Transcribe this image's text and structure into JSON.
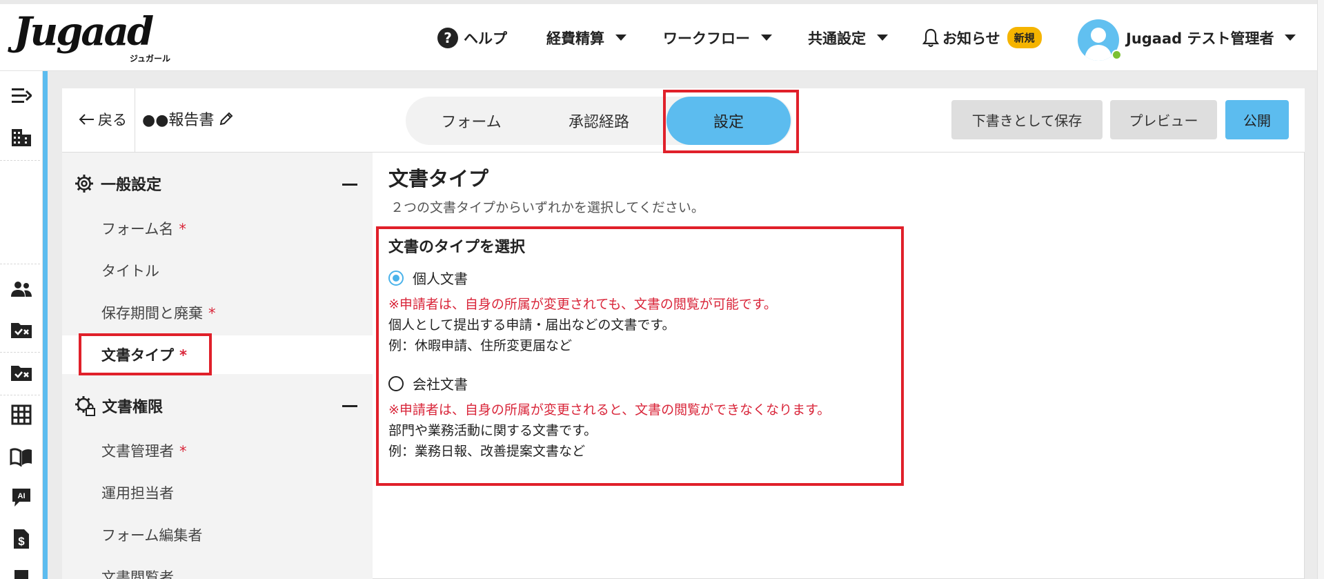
{
  "header": {
    "logo_main": "Jugaad",
    "logo_sub": "ジュガール",
    "nav": {
      "help": "ヘルプ",
      "expense": "経費精算",
      "workflow": "ワークフロー",
      "common_settings": "共通設定",
      "notifications": "お知らせ",
      "new_badge": "新規"
    },
    "user_name": "Jugaad テスト管理者"
  },
  "toolbar": {
    "back": "戻る",
    "doc_title": "●●報告書",
    "tabs": [
      {
        "label": "フォーム",
        "active": false
      },
      {
        "label": "承認経路",
        "active": false
      },
      {
        "label": "設定",
        "active": true
      }
    ],
    "save_draft": "下書きとして保存",
    "preview": "プレビュー",
    "publish": "公開"
  },
  "sidebar": {
    "general": {
      "title": "一般設定",
      "items": [
        {
          "label": "フォーム名",
          "required": true
        },
        {
          "label": "タイトル",
          "required": false
        },
        {
          "label": "保存期間と廃棄",
          "required": true
        },
        {
          "label": "文書タイプ",
          "required": true,
          "active": true
        }
      ]
    },
    "permissions": {
      "title": "文書権限",
      "items": [
        {
          "label": "文書管理者",
          "required": true
        },
        {
          "label": "運用担当者",
          "required": false
        },
        {
          "label": "フォーム編集者",
          "required": false
        },
        {
          "label": "文書閲覧者",
          "required": false
        }
      ]
    },
    "required_mark": "*"
  },
  "content": {
    "title": "文書タイプ",
    "description": "２つの文書タイプからいずれかを選択してください。",
    "select_label": "文書のタイプを選択",
    "options": [
      {
        "label": "個人文書",
        "selected": true,
        "warning": "※申請者は、自身の所属が変更されても、文書の閲覧が可能です。",
        "desc": "個人として提出する申請・届出などの文書です。",
        "example": "例：休暇申請、住所変更届など"
      },
      {
        "label": "会社文書",
        "selected": false,
        "warning": "※申請者は、自身の所属が変更されると、文書の閲覧ができなくなります。",
        "desc": "部門や業務活動に関する文書です。",
        "example": "例：業務日報、改善提案文書など"
      }
    ]
  },
  "colors": {
    "accent": "#5cbcef",
    "highlight": "#e0202a",
    "required": "#d9263a",
    "badge": "#f5b400"
  }
}
